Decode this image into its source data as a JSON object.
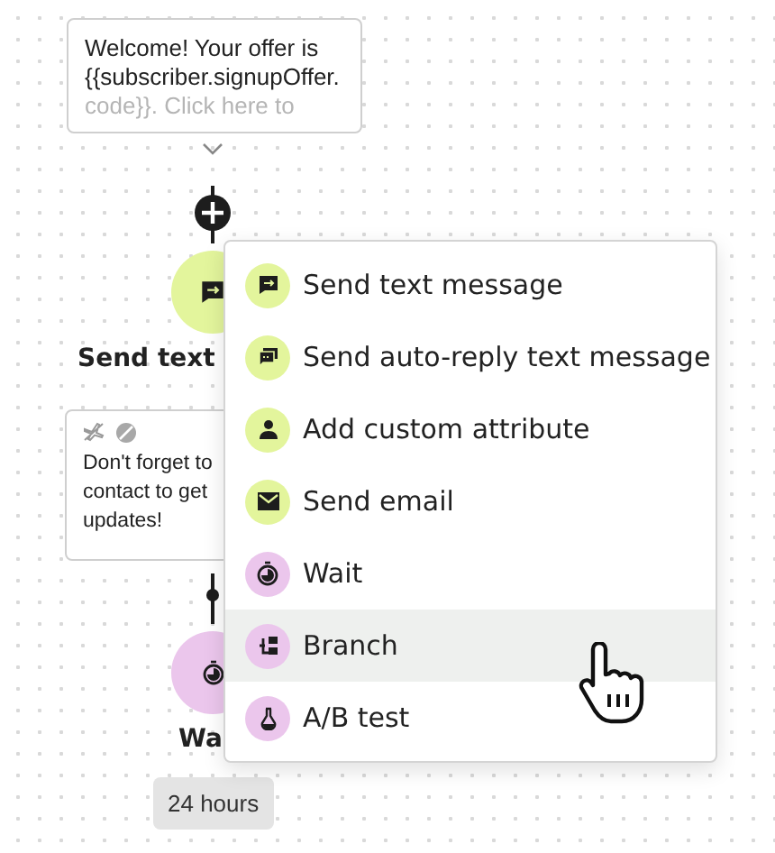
{
  "canvas": {
    "message_card": {
      "lines": [
        "Welcome! Your offer is",
        "{{subscriber.signupOffer.",
        "code}}. Click here to"
      ]
    },
    "nodes": [
      {
        "kind": "send_text",
        "label": "Send text",
        "color": "#e3f59c"
      },
      {
        "kind": "wait",
        "label": "Wa",
        "color": "#ebc6ec",
        "chip": "24 hours"
      }
    ],
    "note_card": {
      "lines": [
        "Don't forget to",
        "contact to get",
        "updates!"
      ]
    }
  },
  "menu": {
    "items": [
      {
        "kind": "sms",
        "label": "Send text message",
        "color": "#e3f59c",
        "selected": false
      },
      {
        "kind": "auto_reply",
        "label": "Send auto-reply text message",
        "color": "#e3f59c",
        "selected": false
      },
      {
        "kind": "attribute",
        "label": "Add custom attribute",
        "color": "#e3f59c",
        "selected": false
      },
      {
        "kind": "email",
        "label": "Send email",
        "color": "#e3f59c",
        "selected": false
      },
      {
        "kind": "wait",
        "label": "Wait",
        "color": "#ebc6ec",
        "selected": false
      },
      {
        "kind": "branch",
        "label": "Branch",
        "color": "#ebc6ec",
        "selected": true
      },
      {
        "kind": "ab_test",
        "label": "A/B test",
        "color": "#ebc6ec",
        "selected": false
      }
    ]
  }
}
